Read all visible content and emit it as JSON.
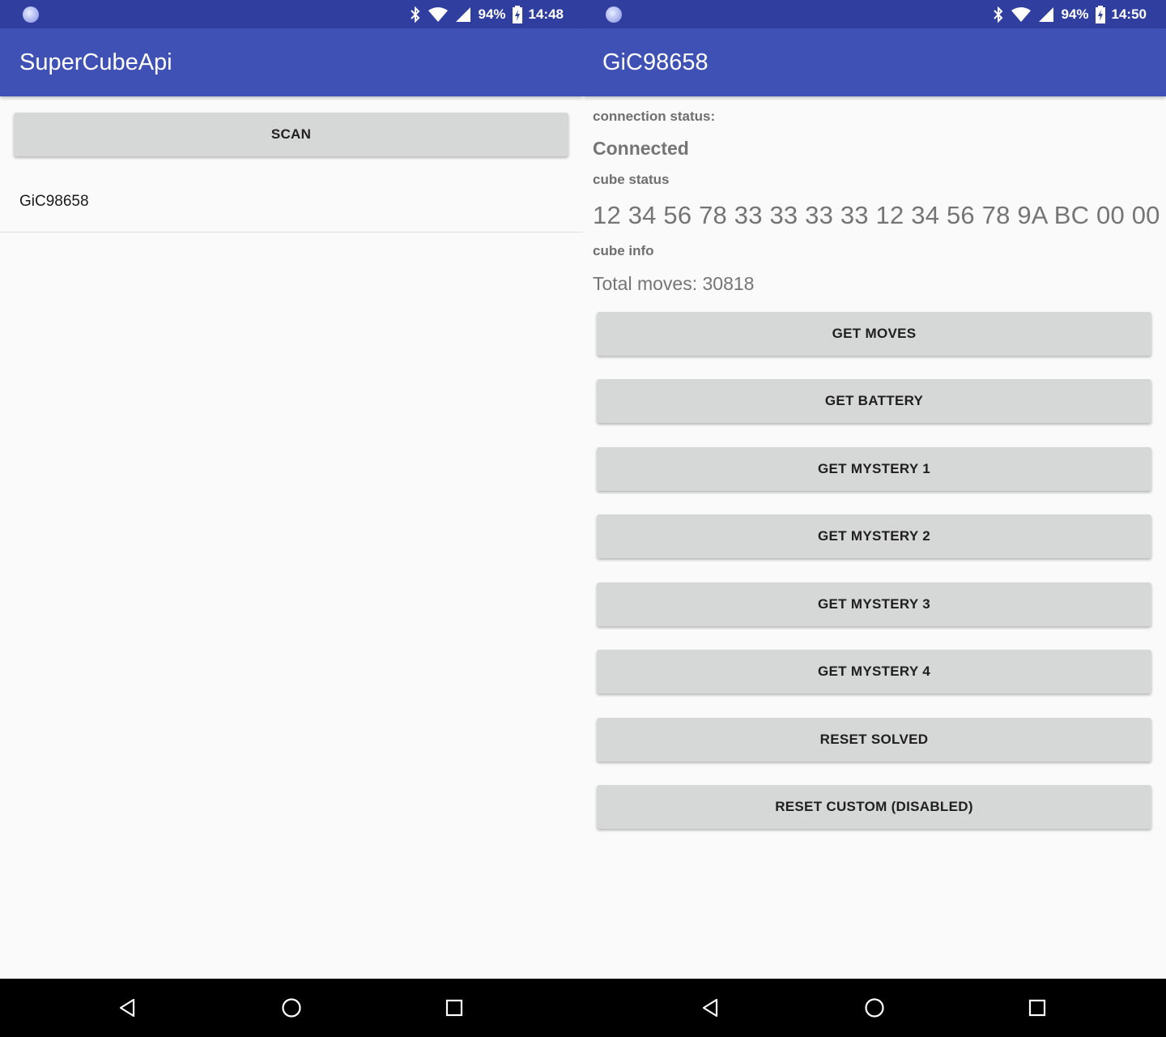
{
  "colors": {
    "status_bar": "#303f9f",
    "app_bar": "#3f51b5",
    "background": "#fafafa",
    "button": "#d6d7d7",
    "nav_bar": "#000000"
  },
  "left_screen": {
    "status_bar": {
      "battery": "94%",
      "time": "14:48",
      "icons": [
        "notification-dot-icon",
        "bluetooth-icon",
        "wifi-icon",
        "cell-signal-icon",
        "battery-charging-icon"
      ]
    },
    "app_bar": {
      "title": "SuperCubeApi"
    },
    "scan_button": "SCAN",
    "devices": [
      "GiC98658"
    ]
  },
  "right_screen": {
    "status_bar": {
      "battery": "94%",
      "time": "14:50",
      "icons": [
        "notification-dot-icon",
        "bluetooth-icon",
        "wifi-icon",
        "cell-signal-icon",
        "battery-charging-icon"
      ]
    },
    "app_bar": {
      "title": "GiC98658"
    },
    "connection_status_label": "connection status:",
    "connection_status_value": "Connected",
    "cube_status_label": "cube status",
    "cube_status_value": "12 34 56 78 33 33 33 33 12 34 56 78 9A BC 00 00",
    "cube_info_label": "cube info",
    "cube_info_value": "Total moves: 30818",
    "buttons": [
      "GET MOVES",
      "GET BATTERY",
      "GET MYSTERY 1",
      "GET MYSTERY 2",
      "GET MYSTERY 3",
      "GET MYSTERY 4",
      "RESET SOLVED",
      "RESET CUSTOM (DISABLED)"
    ]
  },
  "nav_bar": {
    "icons": [
      "back-icon",
      "home-icon",
      "recents-icon"
    ]
  }
}
